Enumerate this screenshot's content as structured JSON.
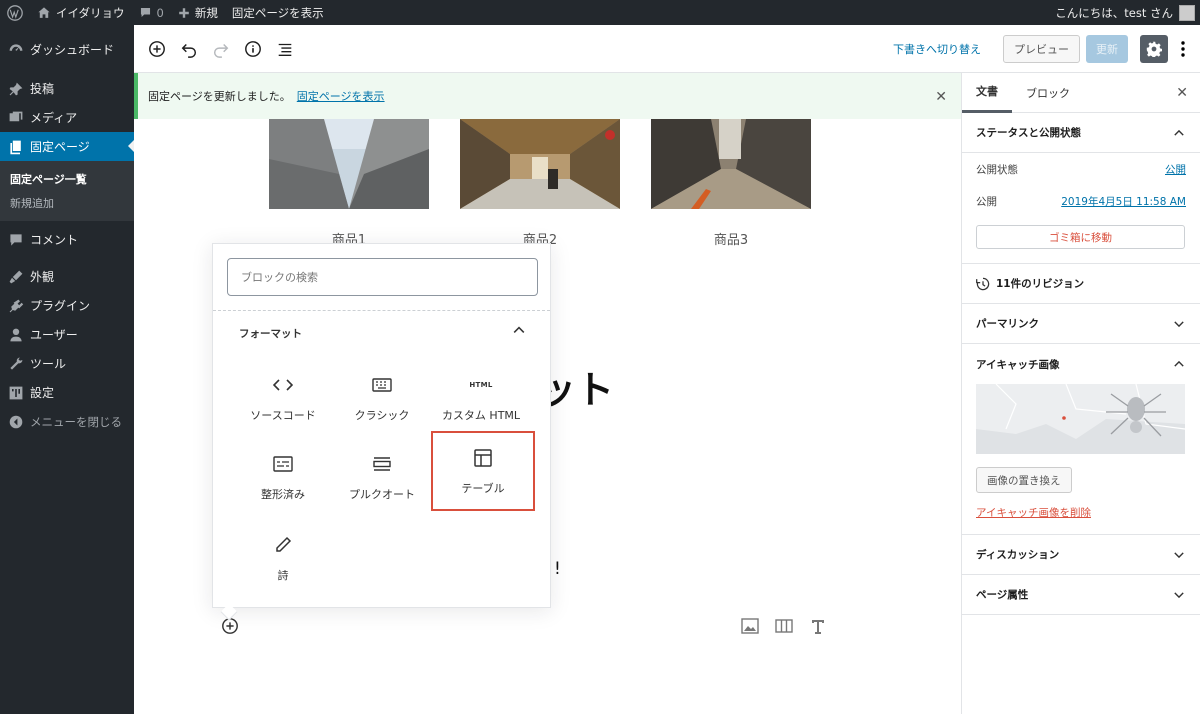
{
  "admin_bar": {
    "site_name": "イイダリョウ",
    "comments_count": "0",
    "new_label": "新規",
    "view_page": "固定ページを表示",
    "greeting": "こんにちは、test さん"
  },
  "sidebar": {
    "items": [
      {
        "label": "ダッシュボード",
        "icon": "dashboard-icon"
      },
      {
        "label": "投稿",
        "icon": "pin-icon"
      },
      {
        "label": "メディア",
        "icon": "media-icon"
      },
      {
        "label": "固定ページ",
        "icon": "pages-icon"
      },
      {
        "label": "コメント",
        "icon": "comment-icon"
      },
      {
        "label": "外観",
        "icon": "appearance-icon"
      },
      {
        "label": "プラグイン",
        "icon": "plugin-icon"
      },
      {
        "label": "ユーザー",
        "icon": "user-icon"
      },
      {
        "label": "ツール",
        "icon": "tools-icon"
      },
      {
        "label": "設定",
        "icon": "settings-icon"
      }
    ],
    "submenu": [
      "固定ページ一覧",
      "新規追加"
    ],
    "collapse": "メニューを閉じる"
  },
  "header": {
    "switch_draft": "下書きへ切り替え",
    "preview": "プレビュー",
    "update": "更新"
  },
  "notice": {
    "message": "固定ページを更新しました。",
    "link": "固定ページを表示"
  },
  "content": {
    "captions": [
      "商品1",
      "商品2",
      "商品3"
    ],
    "heading_fragment": "ット",
    "exclaim": "!"
  },
  "inserter": {
    "search_placeholder": "ブロックの検索",
    "panel_title": "フォーマット",
    "html_glyph": "HTML",
    "blocks": [
      {
        "label": "ソースコード",
        "icon": "code-icon"
      },
      {
        "label": "クラシック",
        "icon": "keyboard-icon"
      },
      {
        "label": "カスタム HTML",
        "icon": "html-icon"
      },
      {
        "label": "整形済み",
        "icon": "preformatted-icon"
      },
      {
        "label": "プルクオート",
        "icon": "pullquote-icon"
      },
      {
        "label": "テーブル",
        "icon": "table-icon"
      },
      {
        "label": "詩",
        "icon": "pencil-icon"
      }
    ]
  },
  "settings": {
    "tabs": [
      "文書",
      "ブロック"
    ],
    "status_panel": "ステータスと公開状態",
    "visibility_label": "公開状態",
    "visibility_value": "公開",
    "publish_label": "公開",
    "publish_date": "2019年4月5日 11:58 AM",
    "trash": "ゴミ箱に移動",
    "revisions": "11件のリビジョン",
    "permalink": "パーマリンク",
    "featured_panel": "アイキャッチ画像",
    "replace_image": "画像の置き換え",
    "remove_image": "アイキャッチ画像を削除",
    "discussion": "ディスカッション",
    "page_attributes": "ページ属性"
  }
}
